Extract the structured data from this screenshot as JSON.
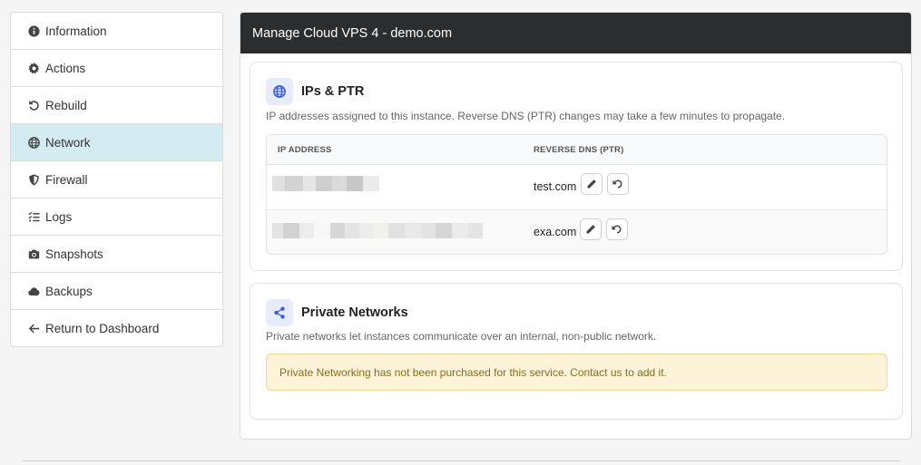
{
  "sidebar": {
    "items": [
      {
        "label": "Information",
        "icon": "info-circle-icon"
      },
      {
        "label": "Actions",
        "icon": "gear-icon"
      },
      {
        "label": "Rebuild",
        "icon": "undo-icon"
      },
      {
        "label": "Network",
        "icon": "globe-icon",
        "active": true
      },
      {
        "label": "Firewall",
        "icon": "shield-icon"
      },
      {
        "label": "Logs",
        "icon": "list-check-icon"
      },
      {
        "label": "Snapshots",
        "icon": "camera-icon"
      },
      {
        "label": "Backups",
        "icon": "cloud-icon"
      },
      {
        "label": "Return to Dashboard",
        "icon": "arrow-left-icon"
      }
    ]
  },
  "header": {
    "title": "Manage Cloud VPS 4 - demo.com"
  },
  "ips_card": {
    "title": "IPs & PTR",
    "icon": "globe-icon",
    "description": "IP addresses assigned to this instance. Reverse DNS (PTR) changes may take a few minutes to propagate.",
    "columns": [
      "IP ADDRESS",
      "REVERSE DNS (PTR)"
    ],
    "rows": [
      {
        "ip": "",
        "ptr": "test.com"
      },
      {
        "ip": "",
        "ptr": "exa.com"
      }
    ]
  },
  "private_card": {
    "title": "Private Networks",
    "icon": "share-nodes-icon",
    "description": "Private networks let instances communicate over an internal, non-public network.",
    "alert": "Private Networking has not been purchased for this service. Contact us to add it."
  },
  "colors": {
    "header_bg": "#2b2d2f",
    "active_item_bg": "#d4ebf1",
    "accent": "#3b5bdb",
    "alert_bg": "#fdf3d8",
    "alert_text": "#8a6d1a"
  }
}
